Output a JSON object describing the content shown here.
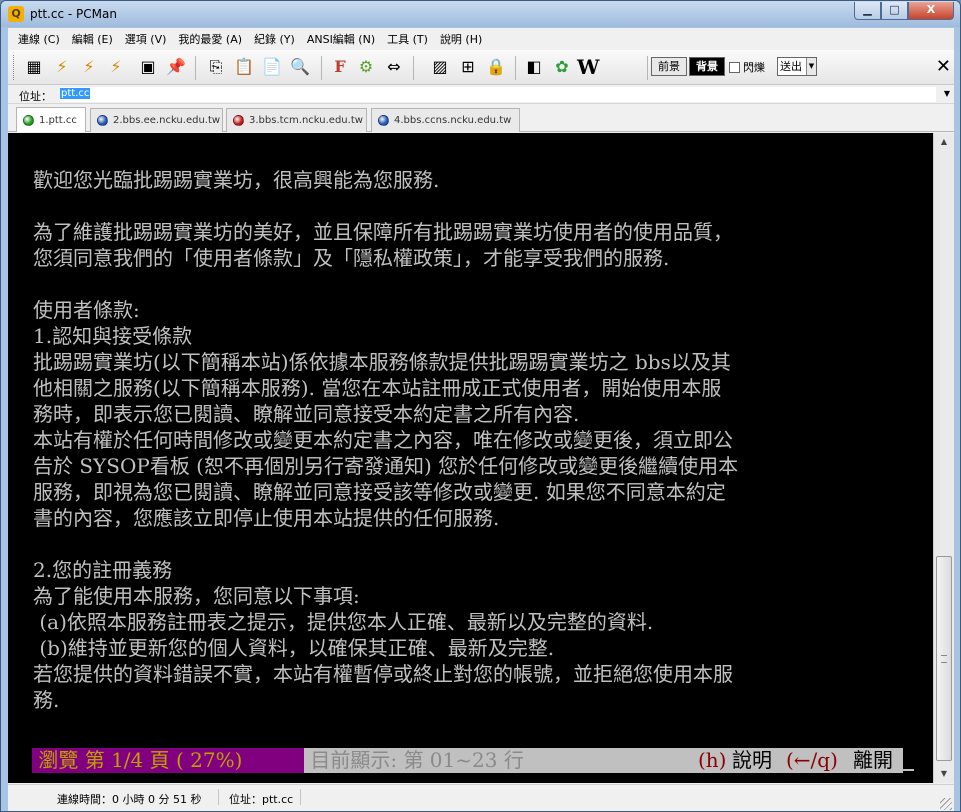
{
  "window": {
    "title": "ptt.cc - PCMan",
    "app_icon_glyph": "Q",
    "controls": {
      "minimize": "▁",
      "maximize": "□",
      "close": "X"
    }
  },
  "menubar": {
    "items": [
      "連線 (C)",
      "編輯 (E)",
      "選項 (V)",
      "我的最愛 (A)",
      "紀錄 (Y)",
      "ANSI編輯 (N)",
      "工具 (T)",
      "說明 (H)"
    ]
  },
  "toolbar": {
    "buttons": [
      {
        "icon": "site-list-icon",
        "glyph": "▦"
      },
      {
        "icon": "connect-icon",
        "glyph": "⚡"
      },
      {
        "icon": "disconnect-icon",
        "glyph": "⚡"
      },
      {
        "icon": "reconnect-icon",
        "glyph": "⚡"
      },
      {
        "icon": "close-connection-icon",
        "glyph": "▣"
      },
      {
        "icon": "add-favorite-icon",
        "glyph": "📌"
      },
      {
        "icon": "copy-icon",
        "glyph": "⎘"
      },
      {
        "icon": "paste-icon",
        "glyph": "📋"
      },
      {
        "icon": "copy-paste-icon",
        "glyph": "📄"
      },
      {
        "icon": "find-icon",
        "glyph": "🔍"
      },
      {
        "icon": "font-icon",
        "glyph": "F"
      },
      {
        "icon": "settings-icon",
        "glyph": "⚙"
      },
      {
        "icon": "fullscreen-icon",
        "glyph": "⇔"
      },
      {
        "icon": "image-icon",
        "glyph": "▨"
      },
      {
        "icon": "ansi-editor-icon",
        "glyph": "⊞"
      },
      {
        "icon": "lock-icon",
        "glyph": "🔒"
      },
      {
        "icon": "blog-icon",
        "glyph": "◧"
      },
      {
        "icon": "flower-icon",
        "glyph": "✿"
      },
      {
        "icon": "wikipedia-icon",
        "glyph": "W"
      }
    ],
    "foreground_label": "前景",
    "background_label": "背景",
    "blink_label": "閃爍",
    "blink_checked": false,
    "send_label": "送出",
    "close_glyph": "✕"
  },
  "address": {
    "label": "位址：",
    "value": "ptt.cc"
  },
  "tabs": [
    {
      "label": "1.ptt.cc",
      "color": "#1a9a1a",
      "active": true
    },
    {
      "label": "2.bbs.ee.ncku.edu.tw",
      "color": "#1f55b5",
      "active": false
    },
    {
      "label": "3.bbs.tcm.ncku.edu.tw",
      "color": "#c01818",
      "active": false
    },
    {
      "label": "4.bbs.ccns.ncku.edu.tw",
      "color": "#1f55b5",
      "active": false
    }
  ],
  "terminal": {
    "lines": [
      "歡迎您光臨批踢踢實業坊，很高興能為您服務.",
      "",
      "為了維護批踢踢實業坊的美好，並且保障所有批踢踢實業坊使用者的使用品質，",
      "您須同意我們的「使用者條款」及「隱私權政策」，才能享受我們的服務.",
      "",
      "使用者條款:",
      "1.認知與接受條款",
      "批踢踢實業坊(以下簡稱本站)係依據本服務條款提供批踢踢實業坊之 bbs以及其",
      "他相關之服務(以下簡稱本服務). 當您在本站註冊成正式使用者，開始使用本服",
      "務時，即表示您已閱讀、瞭解並同意接受本約定書之所有內容.",
      "本站有權於任何時間修改或變更本約定書之內容，唯在修改或變更後，須立即公",
      "告於 SYSOP看板 (恕不再個別另行寄發通知) 您於任何修改或變更後繼續使用本",
      "服務，即視為您已閱讀、瞭解並同意接受該等修改或變更. 如果您不同意本約定",
      "書的內容，您應該立即停止使用本站提供的任何服務.",
      "",
      "2.您的註冊義務",
      "為了能使用本服務，您同意以下事項:",
      " (a)依照本服務註冊表之提示，提供您本人正確、最新以及完整的資料.",
      " (b)維持並更新您的個人資料，以確保其正確、最新及完整.",
      "若您提供的資料錯誤不實，本站有權暫停或終止對您的帳號，並拒絕您使用本服",
      "務."
    ],
    "status": {
      "browse": " 瀏覽 第 1/4 頁 ( 27%) ",
      "display": " 目前顯示: 第 01~23 行",
      "help_key": "(h)",
      "help_label": "說明 ",
      "leave_key": "(←/q)",
      "leave_label": "離開 "
    },
    "colors": {
      "browse_bg": "#800080",
      "browse_fg": "#c0a000",
      "display_bg": "#c0c0c0",
      "display_fg": "#8a8a8a",
      "key_fg": "#8b0000",
      "label_fg": "#000000"
    }
  },
  "statusbar": {
    "connection_time": "連線時間：0 小時 0 分 51 秒",
    "address": "位址：ptt.cc"
  }
}
